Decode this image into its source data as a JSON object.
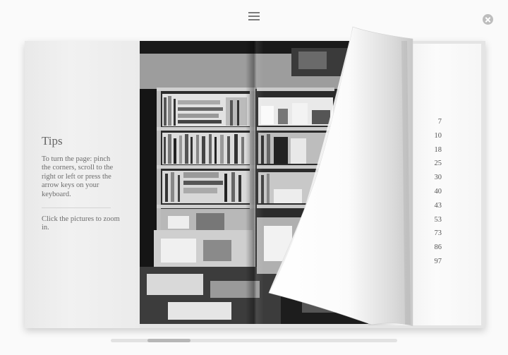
{
  "toolbar": {
    "toc_icon": "list-icon",
    "close_icon": "close-icon"
  },
  "tips": {
    "title": "Tips",
    "turn_page": "To turn the page: pinch the corners, scroll to the right or left or press the arrow keys on your keyboard.",
    "zoom": "Click the pictures to zoom in."
  },
  "contents_pages": [
    "7",
    "10",
    "18",
    "25",
    "30",
    "40",
    "43",
    "53",
    "73",
    "86",
    "97"
  ],
  "scroll": {
    "position": 0.15
  },
  "colors": {
    "background": "#fafafa",
    "page": "#f2f2f2",
    "text": "#6d6d6d"
  }
}
